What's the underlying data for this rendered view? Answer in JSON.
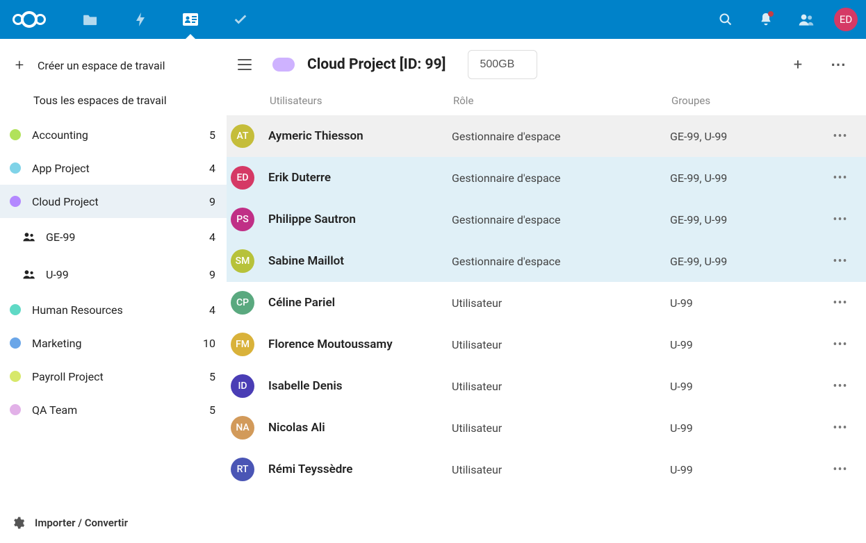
{
  "header": {
    "user_initials": "ED"
  },
  "sidebar": {
    "create_label": "Créer un espace de travail",
    "all_label": "Tous les espaces de travail",
    "footer_label": "Importer / Convertir",
    "items": [
      {
        "label": "Accounting",
        "count": "5",
        "color": "#b1e25a"
      },
      {
        "label": "App Project",
        "count": "4",
        "color": "#7fd3e8"
      },
      {
        "label": "Cloud Project",
        "count": "9",
        "color": "#b388ff"
      },
      {
        "label": "Human Resources",
        "count": "4",
        "color": "#5fd9c5"
      },
      {
        "label": "Marketing",
        "count": "10",
        "color": "#6aa6e8"
      },
      {
        "label": "Payroll Project",
        "count": "5",
        "color": "#d7e86a"
      },
      {
        "label": "QA Team",
        "count": "5",
        "color": "#e2b1e8"
      }
    ],
    "subgroups": [
      {
        "label": "GE-99",
        "count": "4"
      },
      {
        "label": "U-99",
        "count": "9"
      }
    ]
  },
  "main": {
    "title": "Cloud Project [ID: 99]",
    "quota": "500GB",
    "columns": {
      "users": "Utilisateurs",
      "role": "Rôle",
      "groups": "Groupes"
    },
    "users": [
      {
        "initials": "AT",
        "color": "#c5bd3a",
        "name": "Aymeric Thiesson",
        "role": "Gestionnaire d'espace",
        "groups": "GE-99, U-99",
        "hl": "sel"
      },
      {
        "initials": "ED",
        "color": "#d53965",
        "name": "Erik Duterre",
        "role": "Gestionnaire d'espace",
        "groups": "GE-99, U-99",
        "hl": "hl"
      },
      {
        "initials": "PS",
        "color": "#c02f86",
        "name": "Philippe Sautron",
        "role": "Gestionnaire d'espace",
        "groups": "GE-99, U-99",
        "hl": "hl"
      },
      {
        "initials": "SM",
        "color": "#b7c23a",
        "name": "Sabine Maillot",
        "role": "Gestionnaire d'espace",
        "groups": "GE-99, U-99",
        "hl": "hl"
      },
      {
        "initials": "CP",
        "color": "#5aa97f",
        "name": "Céline Pariel",
        "role": "Utilisateur",
        "groups": "U-99",
        "hl": ""
      },
      {
        "initials": "FM",
        "color": "#d9b23a",
        "name": "Florence Moutoussamy",
        "role": "Utilisateur",
        "groups": "U-99",
        "hl": ""
      },
      {
        "initials": "ID",
        "color": "#4a3db5",
        "name": "Isabelle Denis",
        "role": "Utilisateur",
        "groups": "U-99",
        "hl": ""
      },
      {
        "initials": "NA",
        "color": "#d29a5a",
        "name": "Nicolas Ali",
        "role": "Utilisateur",
        "groups": "U-99",
        "hl": ""
      },
      {
        "initials": "RT",
        "color": "#4a55b5",
        "name": "Rémi Teyssèdre",
        "role": "Utilisateur",
        "groups": "U-99",
        "hl": ""
      }
    ]
  }
}
